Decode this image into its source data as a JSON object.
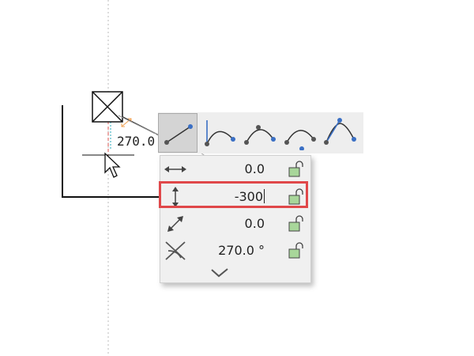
{
  "canvas": {
    "dimension_label": "270.0",
    "colors": {
      "guide": "#bbbbbb",
      "line": "#111111",
      "ref_dash": "#d9534f",
      "orange_marker": "#f0a050",
      "cyan_marker": "#2aaabb"
    }
  },
  "toolbar": {
    "tools": [
      {
        "name": "line-tool",
        "icon": "line-icon",
        "selected": true
      },
      {
        "name": "tangent-arc-tool",
        "icon": "tangent-arc-icon",
        "selected": false
      },
      {
        "name": "three-point-arc-tool",
        "icon": "three-point-arc-icon",
        "selected": false
      },
      {
        "name": "center-arc-tool",
        "icon": "center-arc-icon",
        "selected": false
      },
      {
        "name": "spline-tool",
        "icon": "spline-icon",
        "selected": false
      }
    ]
  },
  "input_panel": {
    "rows": [
      {
        "label_icon": "horizontal-arrow-icon",
        "value": "0.0",
        "lock": "unlocked"
      },
      {
        "label_icon": "vertical-arrow-icon",
        "value": "-300",
        "lock": "unlocked",
        "active": true
      },
      {
        "label_icon": "diagonal-arrow-icon",
        "value": "0.0",
        "lock": "unlocked"
      },
      {
        "label_icon": "angle-icon",
        "value": "270.0 °",
        "lock": "unlocked"
      }
    ],
    "confirm_icon": "checkmark-icon",
    "highlight_color": "#e0484a"
  }
}
